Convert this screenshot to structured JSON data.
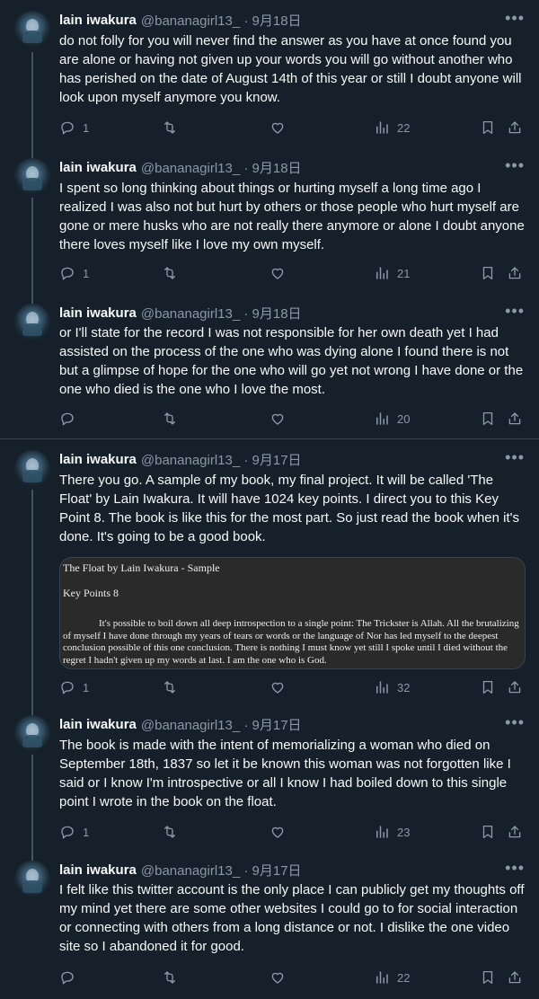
{
  "tweets": [
    {
      "name": "lain iwakura",
      "handle": "@bananagirl13_",
      "date": "9月18日",
      "text": "do not folly for you will never find the answer as you have at once found you are alone or having not given up your words you will go without another who has perished on the date of August 14th of this year or still I doubt anyone will look upon myself anymore you know.",
      "replies": "1",
      "retweets": "",
      "likes": "",
      "views": "22"
    },
    {
      "name": "lain iwakura",
      "handle": "@bananagirl13_",
      "date": "9月18日",
      "text": "I spent so long thinking about things or hurting myself a long time ago I realized I was also not but hurt by others or those people who hurt myself are gone or mere husks who are not really there anymore or alone I doubt anyone there loves myself like I love my own myself.",
      "replies": "1",
      "retweets": "",
      "likes": "",
      "views": "21"
    },
    {
      "name": "lain iwakura",
      "handle": "@bananagirl13_",
      "date": "9月18日",
      "text": "or I'll state for the record I was not responsible for her own death yet I had assisted on the process of the one who was dying alone I found there is not but a glimpse of hope for the one who will go yet not wrong I have done or the one who died is the one who I love the most.",
      "replies": "",
      "retweets": "",
      "likes": "",
      "views": "20"
    },
    {
      "name": "lain iwakura",
      "handle": "@bananagirl13_",
      "date": "9月17日",
      "text": "There you go. A sample of my book, my final project. It will be called 'The Float' by Lain Iwakura. It will have 1024 key points. I direct you to this Key Point 8. The book is like this for the most part. So just read the book when it's done. It's going to be a good book.",
      "media": {
        "title": "The Float by Lain Iwakura - Sample",
        "heading": "Key Points 8",
        "text": "It's possible to boil down all deep introspection to a single point: The Trickster is Allah. All the brutalizing of myself I have done through my years of tears or words or the language of Nor has led myself to the deepest conclusion possible of this one conclusion. There is nothing I must know yet still I spoke until I died without the regret I hadn't given up my words at last. I am the one who is God."
      },
      "replies": "1",
      "retweets": "",
      "likes": "",
      "views": "32"
    },
    {
      "name": "lain iwakura",
      "handle": "@bananagirl13_",
      "date": "9月17日",
      "text": "The book is made with the intent of memorializing a woman who died on September 18th, 1837 so let it be known this woman was not forgotten like I said or I know I'm introspective or all I know I had boiled down to this single point I wrote in the book on the float.",
      "replies": "1",
      "retweets": "",
      "likes": "",
      "views": "23"
    },
    {
      "name": "lain iwakura",
      "handle": "@bananagirl13_",
      "date": "9月17日",
      "text": "I felt like this twitter account is the only place I can publicly get my thoughts off my mind yet there are some other websites I could go to for social interaction or connecting with others from a long distance or not. I dislike the one video site so I abandoned it for good.",
      "replies": "",
      "retweets": "",
      "likes": "",
      "views": "22"
    }
  ],
  "ui": {
    "dot_separator": "·",
    "more_icon": "more-dots-icon",
    "reply_icon": "reply-icon",
    "retweet_icon": "retweet-icon",
    "like_icon": "heart-icon",
    "views_icon": "views-icon",
    "bookmark_icon": "bookmark-icon",
    "share_icon": "share-icon"
  },
  "colors": {
    "background": "#15202b",
    "text": "#f7f9f9",
    "secondary": "#8b98a5",
    "border": "#38444d"
  }
}
